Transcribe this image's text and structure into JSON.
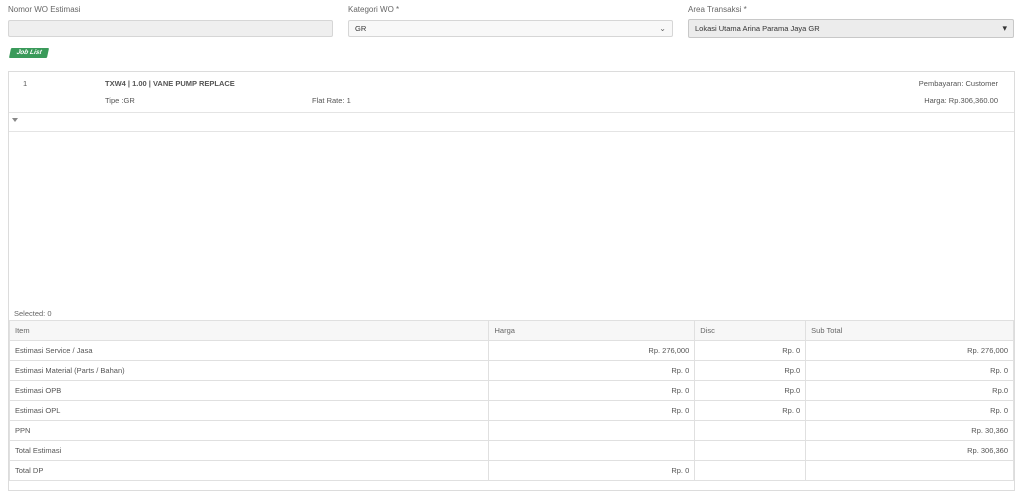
{
  "form": {
    "nomor_label": "Nomor WO Estimasi",
    "nomor_value": "",
    "kategori_label": "Kategori WO *",
    "kategori_value": "GR",
    "area_label": "Area Transaksi *",
    "area_value": "Lokasi Utama Arina Parama Jaya GR"
  },
  "job_list_label": "Job List",
  "job": {
    "no": "1",
    "title": "TXW4 | 1.00 | VANE PUMP REPLACE",
    "tipe": "Tipe :GR",
    "flat_rate": "Flat Rate: 1",
    "pembayaran": "Pembayaran: Customer",
    "harga": "Harga: Rp.306,360.00"
  },
  "selected_text": "Selected: 0",
  "summary": {
    "headers": [
      "Item",
      "Harga",
      "Disc",
      "Sub Total"
    ],
    "rows": [
      [
        "Estimasi Service / Jasa",
        "Rp. 276,000",
        "Rp. 0",
        "Rp. 276,000"
      ],
      [
        "Estimasi Material (Parts / Bahan)",
        "Rp. 0",
        "Rp.0",
        "Rp. 0"
      ],
      [
        "Estimasi OPB",
        "Rp. 0",
        "Rp.0",
        "Rp.0"
      ],
      [
        "Estimasi OPL",
        "Rp. 0",
        "Rp. 0",
        "Rp. 0"
      ],
      [
        "PPN",
        "",
        "",
        "Rp. 30,360"
      ],
      [
        "Total Estimasi",
        "",
        "",
        "Rp. 306,360"
      ],
      [
        "Total DP",
        "Rp. 0",
        "",
        ""
      ]
    ]
  },
  "icons": {
    "dropdown": "chevron-down-icon",
    "expand": "caret-down-icon"
  }
}
